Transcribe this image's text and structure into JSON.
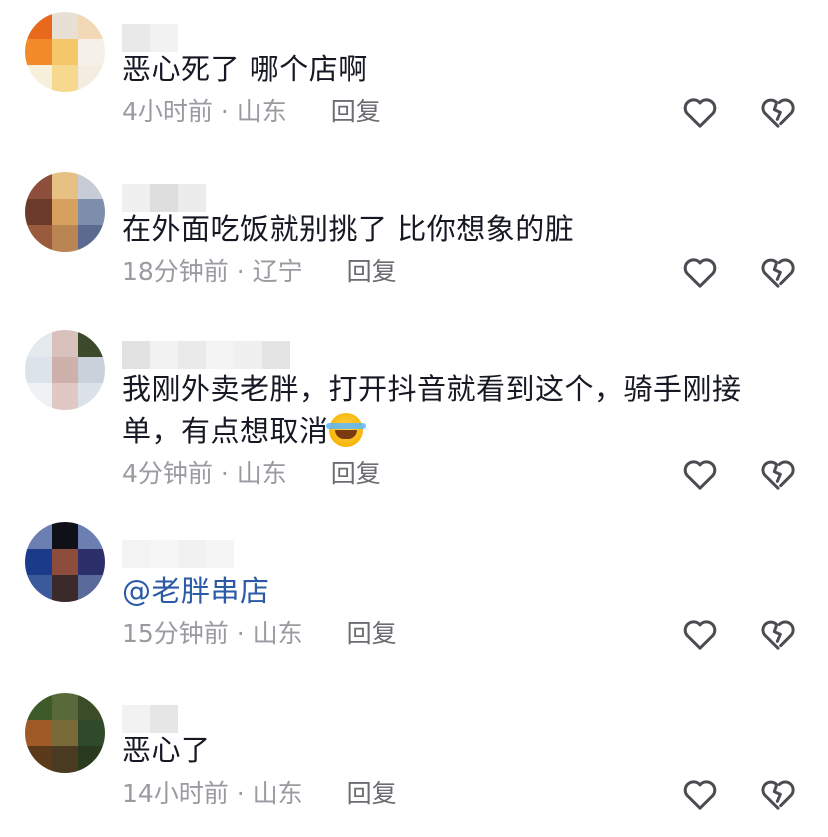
{
  "comments": [
    {
      "text": "恶心死了 哪个店啊",
      "time": "4小时前",
      "location": "山东",
      "reply": "回复",
      "avatar_colors": [
        "#e8681c",
        "#e8e0d4",
        "#f3d8b8",
        "#f38a2a",
        "#f5c66a",
        "#f5f0e8",
        "#f7f0dd",
        "#f6d98e",
        "#f3ece0"
      ]
    },
    {
      "text": "在外面吃饭就别挑了 比你想象的脏",
      "time": "18分钟前",
      "location": "辽宁",
      "reply": "回复",
      "avatar_colors": [
        "#8e4e3c",
        "#e6c183",
        "#c8ccd6",
        "#6b3a2a",
        "#d8a05e",
        "#7f8dad",
        "#9a5a3c",
        "#b98552",
        "#5a6b8f"
      ]
    },
    {
      "text": "我刚外卖老胖，打开抖音就看到这个，骑手刚接单，有点想取消",
      "time": "4分钟前",
      "location": "山东",
      "reply": "回复",
      "avatar_colors": [
        "#e4e9ee",
        "#d9c2bd",
        "#3a4a2a",
        "#dde3ea",
        "#cfb1ac",
        "#c9d2da",
        "#eef2f4",
        "#e0c9c4",
        "#dbe2e8"
      ]
    },
    {
      "mention": "@老胖串店",
      "time": "15分钟前",
      "location": "山东",
      "reply": "回复",
      "avatar_colors": [
        "#6b7fb0",
        "#101018",
        "#6b7fb0",
        "#1b3a8a",
        "#8e4c3c",
        "#2c2f6a",
        "#3a5a9a",
        "#3b2a2a",
        "#5a6a9a"
      ]
    },
    {
      "text": "恶心了",
      "time": "14小时前",
      "location": "山东",
      "reply": "回复",
      "avatar_colors": [
        "#3d5a28",
        "#596a3a",
        "#3a4d28",
        "#a05a28",
        "#7a6a3a",
        "#2f4a2a",
        "#5a3a1a",
        "#4a3a22",
        "#2a3a1e"
      ]
    }
  ],
  "icons": {
    "like": "heart-outline-icon",
    "dislike": "broken-heart-icon"
  }
}
